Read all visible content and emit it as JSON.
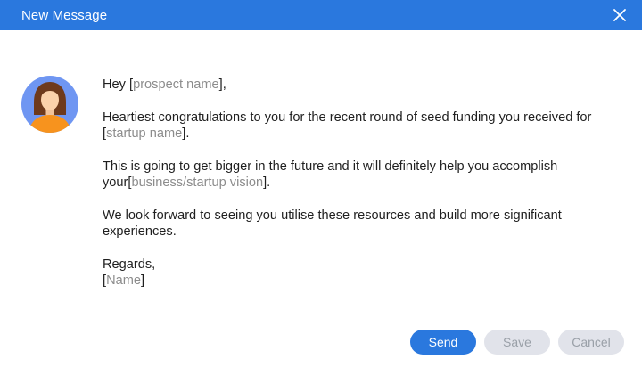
{
  "window": {
    "title": "New Message"
  },
  "message": {
    "greeting_prefix": "Hey ",
    "prospect_placeholder": "prospect name",
    "greeting_suffix": ",",
    "p1_text": "Heartiest congratulations to you for the recent round of seed funding you received for",
    "startup_placeholder": "startup name",
    "p1_end": ".",
    "p2_text": "This is going to get bigger in the future and it will definitely help you accomplish your",
    "vision_placeholder": "business/startup vision",
    "p2_end": ".",
    "p3_text": "We look forward to seeing you utilise these resources and build more significant experiences.",
    "closing": "Regards,",
    "name_placeholder": "Name"
  },
  "actions": {
    "send_label": "Send",
    "save_label": "Save",
    "cancel_label": "Cancel"
  },
  "colors": {
    "accent": "#2a78de",
    "placeholder_text": "#8c8c8c",
    "disabled_button": "#e1e3ea"
  },
  "icons": {
    "close": "close-icon",
    "avatar": "avatar"
  }
}
